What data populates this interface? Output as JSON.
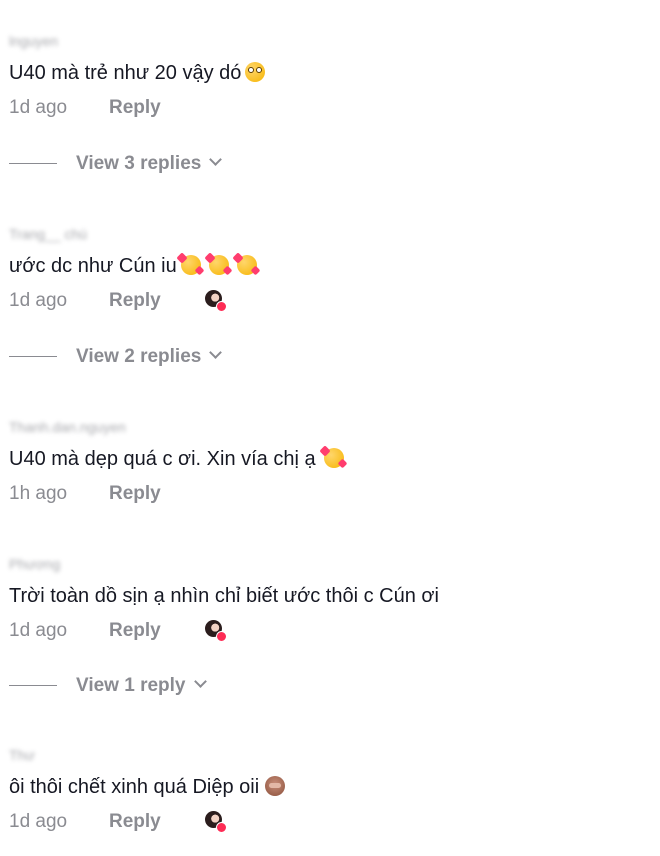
{
  "comments": [
    {
      "username": "lnguyen",
      "text": "U40 mà trẻ như 20 vậy dó",
      "emoji_icons": [
        "flushed-face-icon"
      ],
      "time": "1d ago",
      "reply_label": "Reply",
      "creator_liked": false,
      "view_replies": "View 3 replies"
    },
    {
      "username": "Trang__ chú",
      "text": "ước dc như Cún iu",
      "emoji_icons": [
        "smiling-face-with-hearts-icon",
        "smiling-face-with-hearts-icon",
        "smiling-face-with-hearts-icon"
      ],
      "time": "1d ago",
      "reply_label": "Reply",
      "creator_liked": true,
      "view_replies": "View 2 replies"
    },
    {
      "username": "Thanh.dan.nguyen",
      "text": "U40 mà dẹp quá c ơi. Xin vía chị ạ",
      "emoji_icons": [
        "smiling-face-with-hearts-icon"
      ],
      "time": "1h ago",
      "reply_label": "Reply",
      "creator_liked": false,
      "view_replies": ""
    },
    {
      "username": "Phương",
      "text": "Trời toàn dồ sịn ạ nhìn chỉ biết ước thôi c Cún ơi",
      "emoji_icons": [],
      "time": "1d ago",
      "reply_label": "Reply",
      "creator_liked": true,
      "view_replies": "View 1 reply"
    },
    {
      "username": "Thư",
      "text": "ôi thôi chết xinh quá Diệp oii",
      "emoji_icons": [
        "see-no-evil-monkey-icon"
      ],
      "time": "1d ago",
      "reply_label": "Reply",
      "creator_liked": true,
      "view_replies": ""
    }
  ],
  "colors": {
    "text": "#161823",
    "secondary": "#8a8b91",
    "like_badge": "#fe2c55"
  }
}
